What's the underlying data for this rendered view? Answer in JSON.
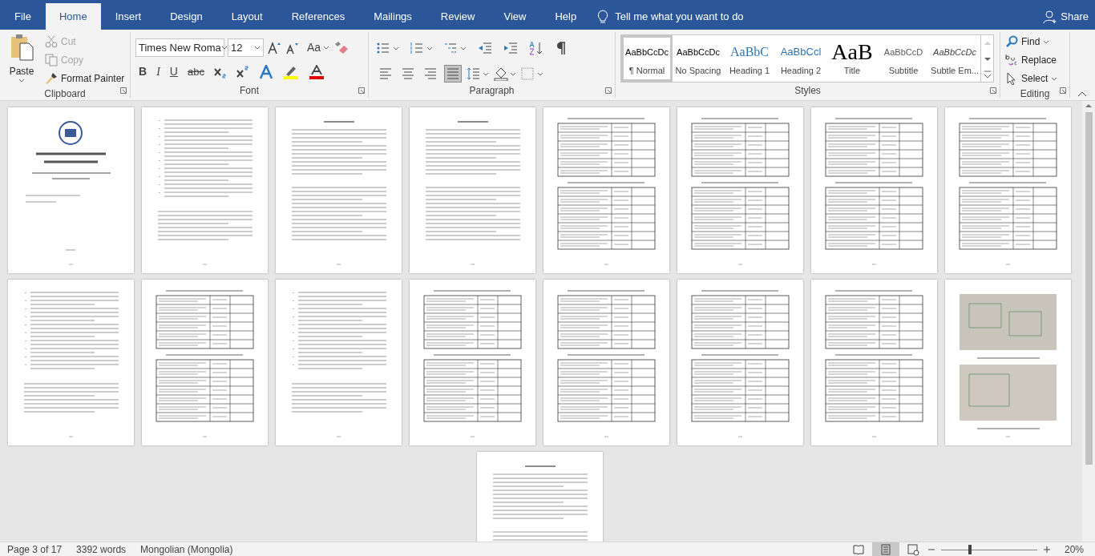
{
  "menu_tabs": [
    {
      "label": "File",
      "selected": false
    },
    {
      "label": "Home",
      "selected": true
    },
    {
      "label": "Insert",
      "selected": false
    },
    {
      "label": "Design",
      "selected": false
    },
    {
      "label": "Layout",
      "selected": false
    },
    {
      "label": "References",
      "selected": false
    },
    {
      "label": "Mailings",
      "selected": false
    },
    {
      "label": "Review",
      "selected": false
    },
    {
      "label": "View",
      "selected": false
    },
    {
      "label": "Help",
      "selected": false
    }
  ],
  "tell_me": {
    "placeholder": "Tell me what you want to do"
  },
  "share": "Share",
  "clipboard": {
    "paste": "Paste",
    "cut": "Cut",
    "copy": "Copy",
    "format_painter": "Format Painter",
    "label": "Clipboard",
    "cut_disabled": true,
    "copy_disabled": true
  },
  "font": {
    "name": "Times New Roma",
    "size": "12",
    "change_case": "Aa",
    "bold": "B",
    "italic": "I",
    "underline": "U",
    "strikethrough": "abc",
    "label": "Font"
  },
  "paragraph": {
    "label": "Paragraph",
    "alignments": [
      {
        "kind": "left",
        "selected": false
      },
      {
        "kind": "center",
        "selected": false
      },
      {
        "kind": "right",
        "selected": false
      },
      {
        "kind": "justify",
        "selected": true
      }
    ]
  },
  "styles": {
    "label": "Styles",
    "items": [
      {
        "preview": "AaBbCcDc",
        "label": "¶ Normal",
        "kind": "normal",
        "selected": true
      },
      {
        "preview": "AaBbCcDc",
        "label": "No Spacing",
        "kind": "normal",
        "selected": false
      },
      {
        "preview": "AaBbC",
        "label": "Heading 1",
        "kind": "heading1",
        "selected": false
      },
      {
        "preview": "AaBbCcl",
        "label": "Heading 2",
        "kind": "heading2",
        "selected": false
      },
      {
        "preview": "AaB",
        "label": "Title",
        "kind": "title",
        "selected": false
      },
      {
        "preview": "AaBbCcD",
        "label": "Subtitle",
        "kind": "subtitle",
        "selected": false
      },
      {
        "preview": "AaBbCcDc",
        "label": "Subtle Em...",
        "kind": "emphasis",
        "selected": false
      }
    ]
  },
  "editing": {
    "label": "Editing",
    "find": "Find",
    "replace": "Replace",
    "select": "Select"
  },
  "pages": [
    {
      "kind": "cover"
    },
    {
      "kind": "list"
    },
    {
      "kind": "text"
    },
    {
      "kind": "text"
    },
    {
      "kind": "table"
    },
    {
      "kind": "table"
    },
    {
      "kind": "table"
    },
    {
      "kind": "table"
    },
    {
      "kind": "list"
    },
    {
      "kind": "table"
    },
    {
      "kind": "list"
    },
    {
      "kind": "table"
    },
    {
      "kind": "table"
    },
    {
      "kind": "table"
    },
    {
      "kind": "table"
    },
    {
      "kind": "image"
    },
    {
      "kind": "text"
    }
  ],
  "status_bar": {
    "page": "Page 3 of 17",
    "words": "3392 words",
    "language": "Mongolian (Mongolia)",
    "zoom": "20%",
    "zoom_slider": {
      "level": 0.29
    },
    "views": [
      {
        "kind": "read",
        "selected": false
      },
      {
        "kind": "print",
        "selected": true
      },
      {
        "kind": "web",
        "selected": false
      }
    ]
  }
}
